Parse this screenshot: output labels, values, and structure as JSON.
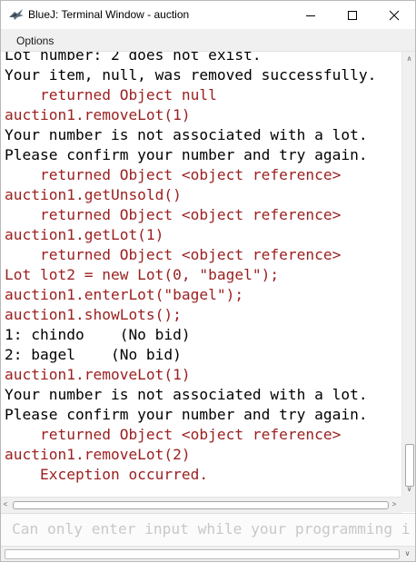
{
  "window": {
    "title": "BlueJ: Terminal Window - auction",
    "minimize_glyph": "—",
    "maximize_glyph": "☐",
    "close_glyph": "✕"
  },
  "menu": {
    "options_label": "Options"
  },
  "terminal": {
    "colors": {
      "output": "#000000",
      "command": "#9b2020"
    },
    "lines": [
      {
        "text": "Lot number: 2 does not exist.",
        "kind": "out"
      },
      {
        "text": "Your item, null, was removed successfully.",
        "kind": "out"
      },
      {
        "text": "    returned Object null",
        "kind": "cmd"
      },
      {
        "text": "auction1.removeLot(1)",
        "kind": "cmd"
      },
      {
        "text": "Your number is not associated with a lot.",
        "kind": "out"
      },
      {
        "text": "Please confirm your number and try again.",
        "kind": "out"
      },
      {
        "text": "    returned Object <object reference>",
        "kind": "cmd"
      },
      {
        "text": "auction1.getUnsold()",
        "kind": "cmd"
      },
      {
        "text": "    returned Object <object reference>",
        "kind": "cmd"
      },
      {
        "text": "auction1.getLot(1)",
        "kind": "cmd"
      },
      {
        "text": "    returned Object <object reference>",
        "kind": "cmd"
      },
      {
        "text": "Lot lot2 = new Lot(0, \"bagel\");",
        "kind": "cmd"
      },
      {
        "text": "auction1.enterLot(\"bagel\");",
        "kind": "cmd"
      },
      {
        "text": "auction1.showLots();",
        "kind": "cmd"
      },
      {
        "text": "1: chindo    (No bid)",
        "kind": "out"
      },
      {
        "text": "2: bagel    (No bid)",
        "kind": "out"
      },
      {
        "text": "auction1.removeLot(1)",
        "kind": "cmd"
      },
      {
        "text": "Your number is not associated with a lot.",
        "kind": "out"
      },
      {
        "text": "Please confirm your number and try again.",
        "kind": "out"
      },
      {
        "text": "    returned Object <object reference>",
        "kind": "cmd"
      },
      {
        "text": "auction1.removeLot(2)",
        "kind": "cmd"
      },
      {
        "text": "    Exception occurred.",
        "kind": "cmd"
      }
    ]
  },
  "input": {
    "placeholder": "Can only enter input while your programming i"
  },
  "scrollbars": {
    "up_arrow": "∧",
    "down_arrow": "∨",
    "left_arrow": "<",
    "right_arrow": ">"
  }
}
